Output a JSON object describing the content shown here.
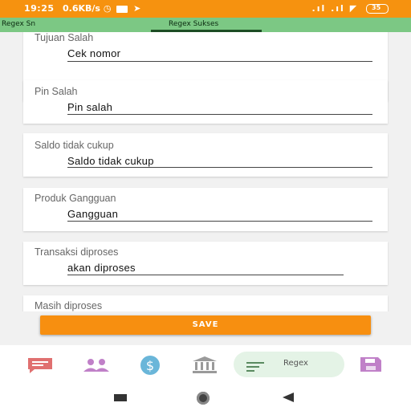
{
  "status_bar": {
    "time": "19:25",
    "speed": "0.6KB/s",
    "battery": "35"
  },
  "tabs": [
    {
      "label": "Regex Sn"
    },
    {
      "label": "Regex Sukses"
    }
  ],
  "cards": [
    {
      "label": "Tujuan Salah",
      "value": "Cek nomor"
    },
    {
      "label": "Pin Salah",
      "value": "Pin salah"
    },
    {
      "label": "Saldo tidak cukup",
      "value": "Saldo tidak cukup"
    },
    {
      "label": "Produk Gangguan",
      "value": "Gangguan"
    },
    {
      "label": "Transaksi diproses",
      "value": "akan diproses"
    },
    {
      "label": "Masih diproses",
      "value": ""
    }
  ],
  "save_label": "SAVE",
  "bottom_nav": {
    "items": [
      {
        "icon": "message-icon"
      },
      {
        "icon": "users-icon"
      },
      {
        "icon": "dollar-icon"
      },
      {
        "icon": "bank-icon"
      },
      {
        "icon": "regex-icon",
        "label": "Regex"
      },
      {
        "icon": "save-icon"
      }
    ]
  },
  "colors": {
    "status_bar": "#f6920f",
    "tab_bar": "#7cc884",
    "accent": "#f78f10",
    "nav_icon": "#c080c8"
  }
}
